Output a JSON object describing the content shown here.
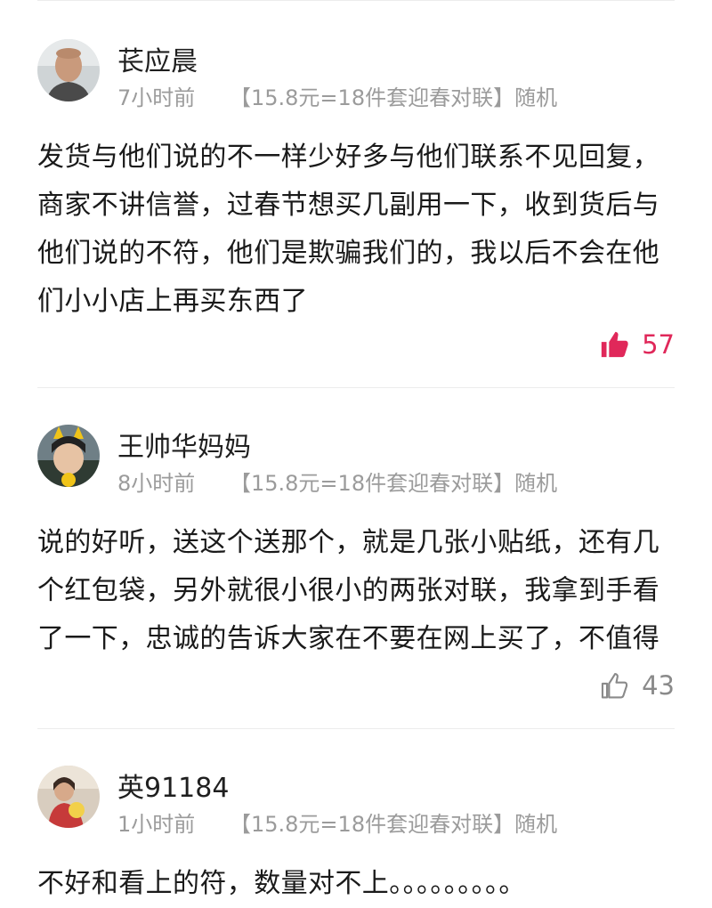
{
  "reviews": [
    {
      "username": "苌应晨",
      "time": "7小时前",
      "variant": "【15.8元=18件套迎春对联】随机",
      "text": "发货与他们说的不一样少好多与他们联系不见回复，商家不讲信誉，过春节想买几副用一下，收到货后与他们说的不符，他们是欺骗我们的，我以后不会在他们小小店上再买东西了",
      "likes": "57",
      "liked": true
    },
    {
      "username": "王帅华妈妈",
      "time": "8小时前",
      "variant": "【15.8元=18件套迎春对联】随机",
      "text": "说的好听，送这个送那个，就是几张小贴纸，还有几个红包袋，另外就很小很小的两张对联，我拿到手看了一下，忠诚的告诉大家在不要在网上买了，不值得",
      "likes": "43",
      "liked": false
    },
    {
      "username": "英91184",
      "time": "1小时前",
      "variant": "【15.8元=18件套迎春对联】随机",
      "text": "不好和看上的符，数量对不上。。。。。。。。。"
    }
  ],
  "icons": {
    "like_filled": "thumbs-up-filled-icon",
    "like_outline": "thumbs-up-outline-icon"
  },
  "colors": {
    "liked": "#e0285a",
    "meta": "#9b9b9b"
  }
}
